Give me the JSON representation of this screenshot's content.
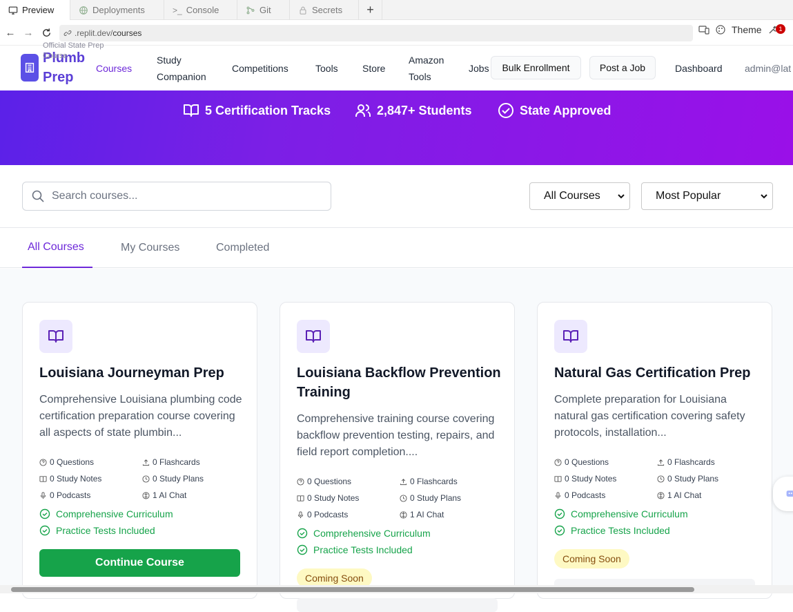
{
  "browser": {
    "tabs": [
      {
        "label": "Preview",
        "icon": "monitor-icon"
      },
      {
        "label": "Deployments",
        "icon": "globe-icon"
      },
      {
        "label": "Console",
        "icon": "terminal-icon"
      },
      {
        "label": "Git",
        "icon": "git-icon"
      },
      {
        "label": "Secrets",
        "icon": "lock-icon"
      }
    ],
    "url_prefix": ".replit.dev/",
    "url_path": "courses",
    "theme_label": "Theme",
    "notification_count": "1"
  },
  "header": {
    "logo_title": "Plumb Prep",
    "logo_subtitle": "Official State Prep Course",
    "nav": [
      "Courses",
      "Study Companion",
      "Competitions",
      "Tools",
      "Store",
      "Amazon Tools",
      "Jobs"
    ],
    "bulk_enrollment": "Bulk Enrollment",
    "post_job": "Post a Job",
    "dashboard": "Dashboard",
    "user": "admin@lat"
  },
  "hero": {
    "stats": [
      "5 Certification Tracks",
      "2,847+ Students",
      "State Approved"
    ]
  },
  "filters": {
    "search_placeholder": "Search courses...",
    "category_selected": "All Courses",
    "sort_selected": "Most Popular"
  },
  "course_tabs": [
    "All Courses",
    "My Courses",
    "Completed"
  ],
  "courses": [
    {
      "title": "Louisiana Journeyman Prep",
      "description": "Comprehensive Louisiana plumbing code certification preparation course covering all aspects of state plumbin...",
      "questions": "0 Questions",
      "flashcards": "0 Flashcards",
      "notes": "0 Study Notes",
      "plans": "0 Study Plans",
      "podcasts": "0 Podcasts",
      "chat": "1 AI Chat",
      "features": [
        "Comprehensive Curriculum",
        "Practice Tests Included"
      ],
      "action": "Continue Course"
    },
    {
      "title": "Louisiana Backflow Prevention Training",
      "description": "Comprehensive training course covering backflow prevention testing, repairs, and field report completion....",
      "questions": "0 Questions",
      "flashcards": "0 Flashcards",
      "notes": "0 Study Notes",
      "plans": "0 Study Plans",
      "podcasts": "0 Podcasts",
      "chat": "1 AI Chat",
      "features": [
        "Comprehensive Curriculum",
        "Practice Tests Included"
      ],
      "action": "Coming Soon"
    },
    {
      "title": "Natural Gas Certification Prep",
      "description": "Complete preparation for Louisiana natural gas certification covering safety protocols, installation...",
      "questions": "0 Questions",
      "flashcards": "0 Flashcards",
      "notes": "0 Study Notes",
      "plans": "0 Study Plans",
      "podcasts": "0 Podcasts",
      "chat": "1 AI Chat",
      "features": [
        "Comprehensive Curriculum",
        "Practice Tests Included"
      ],
      "action": "Coming Soon"
    }
  ]
}
